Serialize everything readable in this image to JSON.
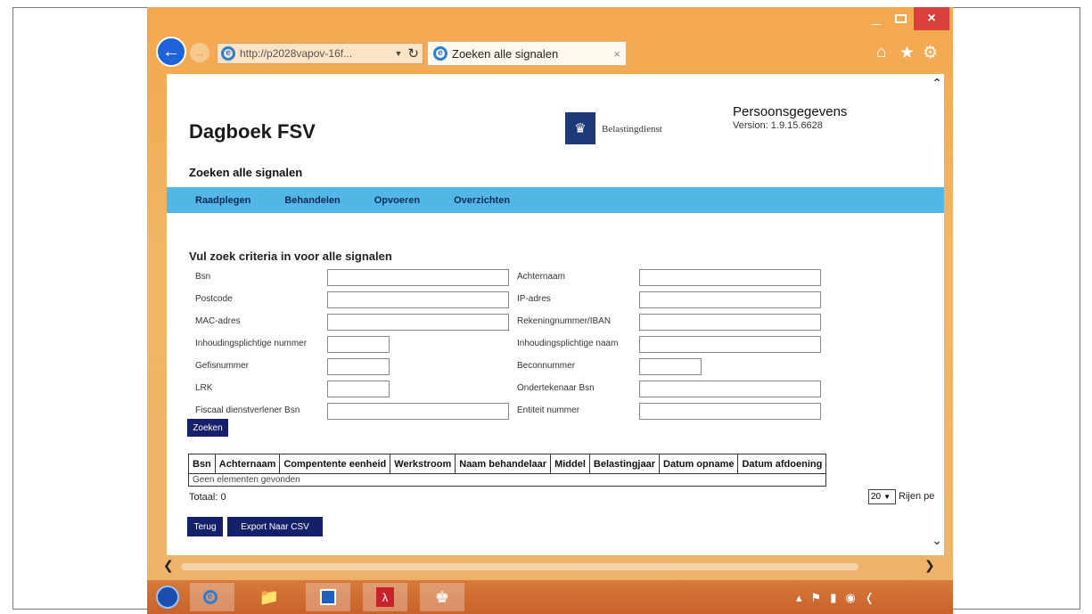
{
  "browser": {
    "address": "http://p2028vapov-16f...",
    "tab_title": "Zoeken alle signalen",
    "tab_close": "×",
    "win_min": "_",
    "win_close": "×"
  },
  "header": {
    "app_title": "Dagboek FSV",
    "org_name": "Belastingdienst",
    "persoons_label": "Persoonsgegevens",
    "version": "Version: 1.9.15.6628"
  },
  "page": {
    "subtitle": "Zoeken alle signalen",
    "section_heading": "Vul zoek criteria in voor alle signalen"
  },
  "menu": [
    "Raadplegen",
    "Behandelen",
    "Opvoeren",
    "Overzichten"
  ],
  "form": {
    "left": [
      {
        "label": "Bsn",
        "value": ""
      },
      {
        "label": "Postcode",
        "value": ""
      },
      {
        "label": "MAC-adres",
        "value": ""
      },
      {
        "label": "Inhoudingsplichtige nummer",
        "value": ""
      },
      {
        "label": "Gefisnummer",
        "value": ""
      },
      {
        "label": "LRK",
        "value": ""
      },
      {
        "label": "Fiscaal dienstverlener Bsn",
        "value": ""
      }
    ],
    "right": [
      {
        "label": "Achternaam",
        "value": ""
      },
      {
        "label": "IP-adres",
        "value": ""
      },
      {
        "label": "Rekeningnummer/IBAN",
        "value": ""
      },
      {
        "label": "Inhoudingsplichtige naam",
        "value": ""
      },
      {
        "label": "Beconnummer",
        "value": ""
      },
      {
        "label": "Ondertekenaar Bsn",
        "value": ""
      },
      {
        "label": "Entiteit nummer",
        "value": ""
      }
    ],
    "search_button": "Zoeken"
  },
  "results": {
    "columns": [
      "Bsn",
      "Achternaam",
      "Compentente eenheid",
      "Werkstroom",
      "Naam behandelaar",
      "Middel",
      "Belastingjaar",
      "Datum opname",
      "Datum afdoening"
    ],
    "empty_message": "Geen elementen gevonden",
    "total": "Totaal: 0",
    "rows_per_page_value": "20",
    "rows_per_page_label": "Rijen pe"
  },
  "actions": {
    "back_label": "Terug",
    "export_label": "Export Naar CSV"
  },
  "colors": {
    "accent_menu": "#52b6e6",
    "button_navy": "#15206b",
    "window_frame": "#f0b665",
    "logo_blue": "#1d3a78"
  }
}
